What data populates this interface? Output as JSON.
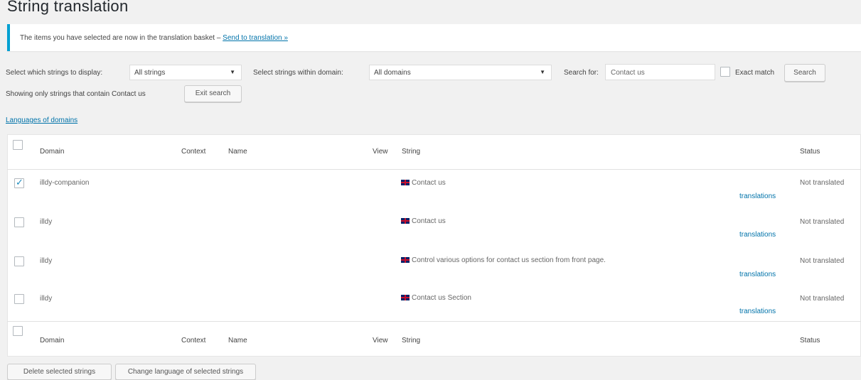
{
  "page": {
    "title": "String translation"
  },
  "notice": {
    "message": "The items you have selected are now in the translation basket – ",
    "link": "Send to translation »"
  },
  "filters": {
    "display_label": "Select which strings to display:",
    "display_value": "All strings",
    "domain_label": "Select strings within domain:",
    "domain_value": "All domains",
    "search_label": "Search for:",
    "search_value": "Contact us",
    "exact_match_label": "Exact match",
    "search_button": "Search",
    "showing_text": "Showing only strings that contain Contact us",
    "exit_search_button": "Exit search",
    "languages_link": "Languages of domains"
  },
  "table": {
    "columns": {
      "domain": "Domain",
      "context": "Context",
      "name": "Name",
      "view": "View",
      "string": "String",
      "status": "Status"
    },
    "rows": [
      {
        "checked": true,
        "domain": "illdy-companion",
        "string": "Contact us",
        "translations": "translations",
        "status": "Not translated"
      },
      {
        "checked": false,
        "domain": "illdy",
        "string": "Contact us",
        "translations": "translations",
        "status": "Not translated"
      },
      {
        "checked": false,
        "domain": "illdy",
        "string": "Control various options for contact us section from front page.",
        "translations": "translations",
        "status": "Not translated"
      },
      {
        "checked": false,
        "domain": "illdy",
        "string": "Contact us Section",
        "translations": "translations",
        "status": "Not translated"
      }
    ]
  },
  "actions": {
    "delete_button": "Delete selected strings",
    "change_language_button": "Change language of selected strings"
  },
  "colors": {
    "link": "#0073aa",
    "accent": "#00a0d2",
    "background": "#f1f1f1"
  }
}
